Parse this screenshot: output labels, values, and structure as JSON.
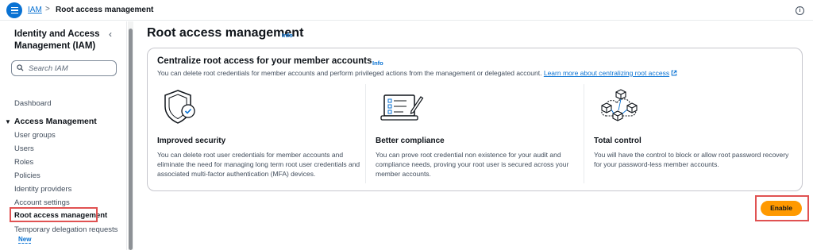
{
  "breadcrumb": {
    "root": "IAM",
    "separator": ">",
    "current": "Root access management"
  },
  "header": {
    "info_icon": "i"
  },
  "sidebar": {
    "title": "Identity and Access Management (IAM)",
    "collapse_icon": "‹",
    "search_placeholder": "Search IAM",
    "dashboard": "Dashboard",
    "section": "Access Management",
    "items": [
      "User groups",
      "Users",
      "Roles",
      "Policies",
      "Identity providers",
      "Account settings",
      "Root access management",
      "Temporary delegation requests"
    ],
    "new_badge": "New"
  },
  "main": {
    "title": "Root access management",
    "title_info": "Info",
    "card": {
      "title": "Centralize root access for your member accounts",
      "info": "Info",
      "description": "You can delete root credentials for member accounts and perform privileged actions from the management or delegated account.",
      "learn_more": "Learn more about centralizing root access",
      "features": [
        {
          "icon": "shield-check-icon",
          "title": "Improved security",
          "description": "You can delete root user credentials for member accounts and eliminate the need for managing long term root user credentials and associated multi-factor authentication (MFA) devices."
        },
        {
          "icon": "compliance-checklist-icon",
          "title": "Better compliance",
          "description": "You can prove root credential non existence for your audit and compliance needs, proving your root user is secured across your member accounts."
        },
        {
          "icon": "cloud-cubes-icon",
          "title": "Total control",
          "description": "You will have the control to block or allow root password recovery for your password-less member accounts."
        }
      ]
    },
    "enable_button": "Enable"
  },
  "colors": {
    "accent": "#0972d3",
    "primary_button": "#ff9900",
    "highlight": "#e05252"
  }
}
